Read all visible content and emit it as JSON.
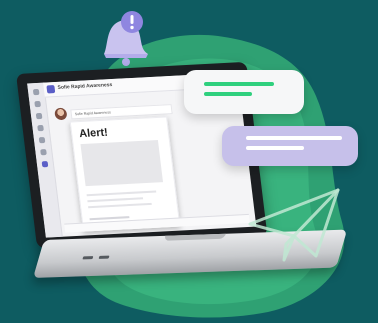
{
  "teams_window": {
    "app_title": "Sofie Rapid Awareness",
    "tabs": [
      "",
      ""
    ],
    "chat_sender": "Sofie Rapid Awareness",
    "chat_time": ""
  },
  "alert_card": {
    "title": "Alert!"
  },
  "icons": {
    "bell": "bell-alert-icon",
    "paper_plane": "paper-plane-icon",
    "exclamation": "!"
  },
  "colors": {
    "background": "#0e5c61",
    "blob_green": "#36b27c",
    "bubble_green_lines": "#2fd07e",
    "bubble_purple": "#c6c0ea",
    "teams_purple": "#5b5fc7"
  }
}
